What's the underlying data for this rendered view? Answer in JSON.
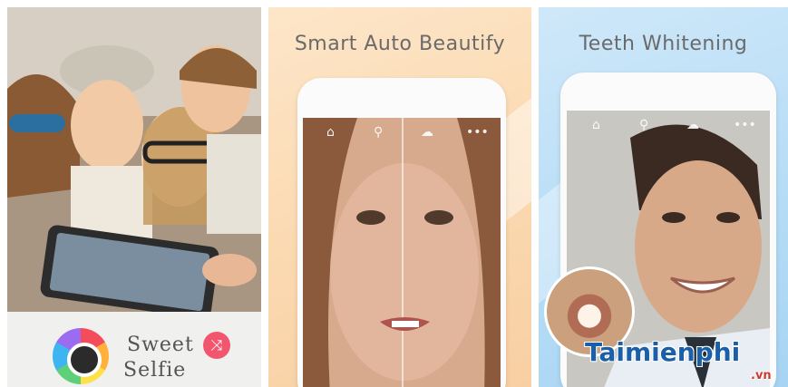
{
  "panels": [
    {
      "brand": {
        "line1": "Sweet",
        "line2": "Selfie"
      }
    },
    {
      "caption": "Smart Auto Beautify",
      "fx_icon": "shuffle-icon"
    },
    {
      "caption": "Teeth Whitening"
    }
  ],
  "toolbar_icons": [
    "home-icon",
    "magic-wand-icon",
    "cloud-icon",
    "more-icon"
  ],
  "watermark": {
    "text": "Taimienphi",
    "suffix": ".vn"
  },
  "colors": {
    "panel2_bg": "#fbd9b0",
    "panel3_bg": "#b5dcf6",
    "accent_pink": "#f2566f",
    "watermark_blue": "#1b5fa8",
    "watermark_red": "#d0392b"
  }
}
